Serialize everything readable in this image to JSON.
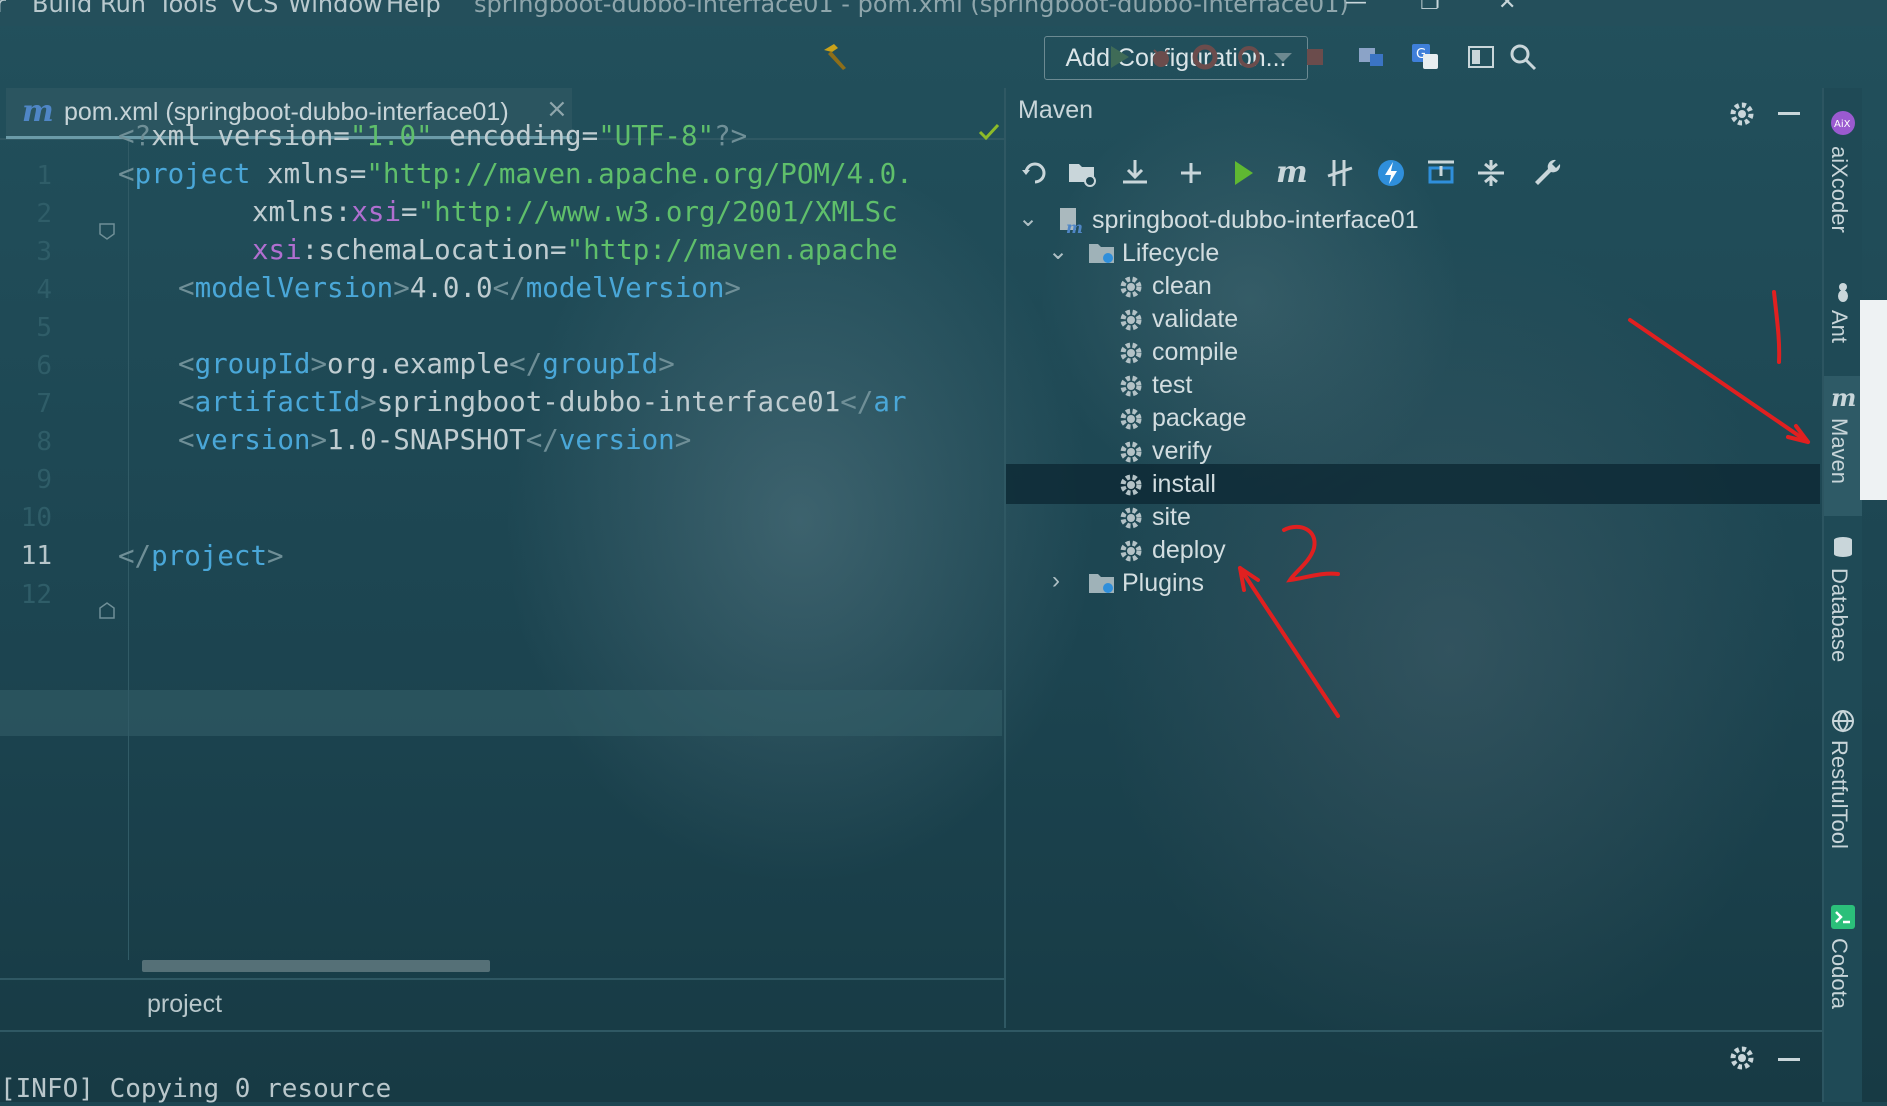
{
  "menubar": {
    "items": [
      "Build",
      "Run",
      "Tools",
      "VCS",
      "Window",
      "Help"
    ],
    "title": "springboot-dubbo-interface01 - pom.xml (springboot-dubbo-interface01)"
  },
  "toolbar": {
    "add_configuration_label": "Add Configuration..."
  },
  "editor": {
    "tab_label": "pom.xml (springboot-dubbo-interface01)",
    "line_numbers": [
      "1",
      "2",
      "3",
      "4",
      "5",
      "6",
      "7",
      "8",
      "9",
      "10",
      "11",
      "12"
    ],
    "current_line": "11",
    "lines": [
      {
        "t1": "<?",
        "t2": "xml version=",
        "t3": "\"1.0\"",
        "t4": " encoding=",
        "t5": "\"UTF-8\"",
        "t6": "?>"
      },
      {
        "a": "<",
        "b": "project",
        "c": " xmlns=",
        "d": "\"http://maven.apache.org/POM/4.0."
      },
      {
        "c": "xmlns:",
        "n": "xsi",
        "e": "=",
        "d": "\"http://www.w3.org/2001/XMLSc"
      },
      {
        "n": "xsi",
        "c": ":schemaLocation=",
        "d": "\"http://maven.apache"
      },
      {
        "a": "<",
        "b": "modelVersion",
        "v": "4.0.0",
        "a2": "</",
        "b2": "modelVersion",
        "e": ">"
      },
      {
        "a": "<",
        "b": "groupId",
        "v": "org.example",
        "a2": "</",
        "b2": "groupId",
        "e": ">"
      },
      {
        "a": "<",
        "b": "artifactId",
        "v": "springboot-dubbo-interface01",
        "a2": "</",
        "b2": "ar"
      },
      {
        "a": "<",
        "b": "version",
        "v": "1.0-SNAPSHOT",
        "a2": "</",
        "b2": "version",
        "e": ">"
      },
      {
        "a": "</",
        "b": "project",
        "e": ">"
      }
    ],
    "breadcrumb": "project"
  },
  "maven": {
    "title": "Maven",
    "project": "springboot-dubbo-interface01",
    "lifecycle_label": "Lifecycle",
    "phases": [
      "clean",
      "validate",
      "compile",
      "test",
      "package",
      "verify",
      "install",
      "site",
      "deploy"
    ],
    "selected_phase": "install",
    "plugins_label": "Plugins"
  },
  "right_strip": {
    "tools": [
      "aiXcoder",
      "Ant",
      "Maven",
      "Database",
      "RestfulTool",
      "Codota"
    ]
  },
  "console": {
    "line": "[INFO] Copying 0 resource"
  },
  "colors": {
    "accent_blue": "#4aa7d8",
    "string_green": "#5fbf6b",
    "annotation_red": "#e02020",
    "selection": "#0e2a36"
  }
}
